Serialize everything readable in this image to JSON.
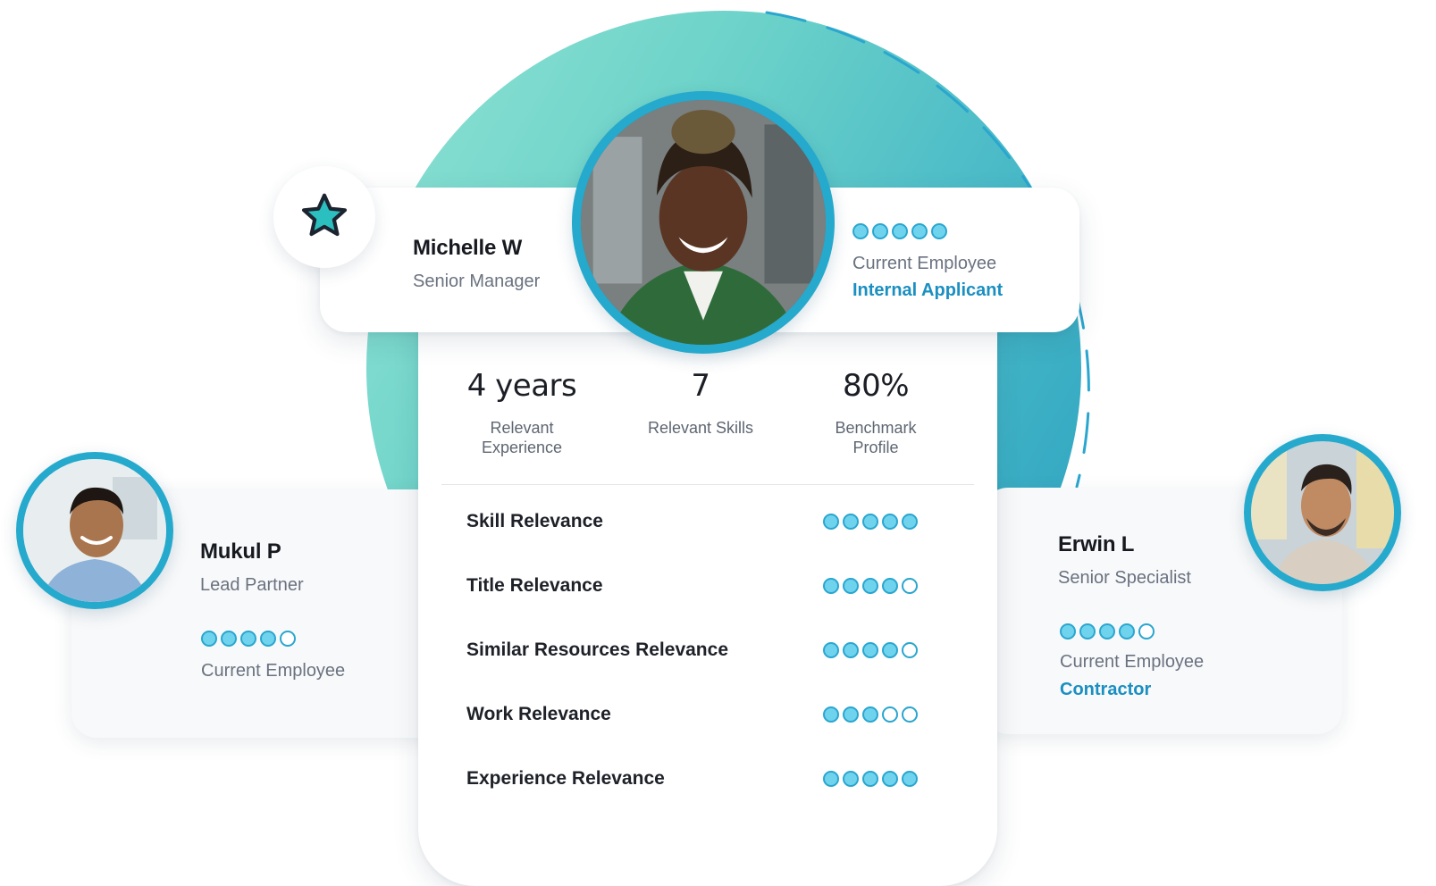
{
  "featured": {
    "name": "Michelle W",
    "title": "Senior Manager",
    "rating": 5,
    "status": "Current Employee",
    "tag": "Internal Applicant",
    "stats": [
      {
        "value": "4 years",
        "label_line1": "Relevant",
        "label_line2": "Experience"
      },
      {
        "value": "7",
        "label_line1": "Relevant Skills",
        "label_line2": ""
      },
      {
        "value": "80%",
        "label_line1": "Benchmark",
        "label_line2": "Profile"
      }
    ],
    "relevance": [
      {
        "label": "Skill Relevance",
        "rating": 5
      },
      {
        "label": "Title Relevance",
        "rating": 4
      },
      {
        "label": "Similar Resources Relevance",
        "rating": 4
      },
      {
        "label": "Work Relevance",
        "rating": 3
      },
      {
        "label": "Experience Relevance",
        "rating": 5
      }
    ]
  },
  "left_candidate": {
    "name": "Mukul P",
    "title": "Lead Partner",
    "rating": 4,
    "status": "Current Employee"
  },
  "right_candidate": {
    "name": "Erwin L",
    "title": "Senior Specialist",
    "rating": 4,
    "status": "Current Employee",
    "tag": "Contractor"
  },
  "colors": {
    "accent": "#1a8fc1",
    "dot_fill": "#6fd3ee",
    "dot_border": "#2aa6cf",
    "ring": "#25a9cc",
    "gradient_start": "#8fe3d3",
    "gradient_end": "#2aa0bf"
  },
  "icons": {
    "badge": "star-icon"
  }
}
